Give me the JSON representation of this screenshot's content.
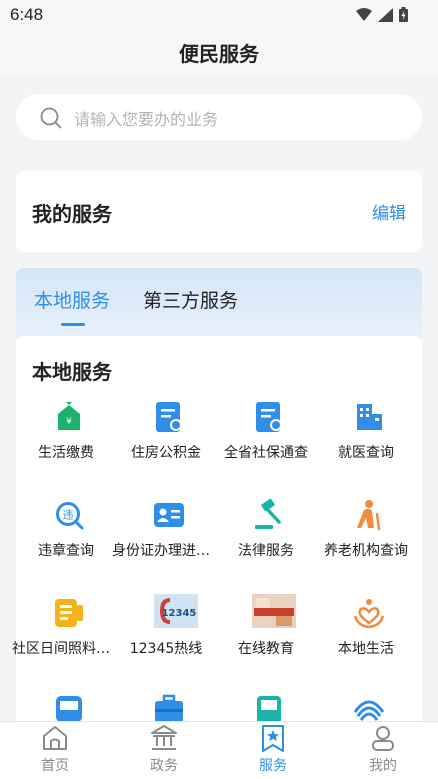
{
  "status": {
    "time": "6:48"
  },
  "header": {
    "title": "便民服务"
  },
  "search": {
    "placeholder": "请输入您要办的业务"
  },
  "my_services": {
    "title": "我的服务",
    "edit_label": "编辑"
  },
  "tabs": [
    {
      "label": "本地服务",
      "active": true
    },
    {
      "label": "第三方服务",
      "active": false
    }
  ],
  "local": {
    "title": "本地服务",
    "items": [
      {
        "label": "生活缴费",
        "icon": "bill-house-icon"
      },
      {
        "label": "住房公积金",
        "icon": "housing-fund-icon"
      },
      {
        "label": "全省社保通查",
        "icon": "social-security-icon"
      },
      {
        "label": "就医查询",
        "icon": "hospital-icon"
      },
      {
        "label": "违章查询",
        "icon": "violation-icon"
      },
      {
        "label": "身份证办理进度查询",
        "icon": "id-card-icon"
      },
      {
        "label": "法律服务",
        "icon": "gavel-icon"
      },
      {
        "label": "养老机构查询",
        "icon": "elderly-icon"
      },
      {
        "label": "社区日间照料中心",
        "icon": "community-care-icon"
      },
      {
        "label": "12345热线",
        "icon": "hotline-12345-icon"
      },
      {
        "label": "在线教育",
        "icon": "education-icon"
      },
      {
        "label": "本地生活",
        "icon": "local-life-icon"
      },
      {
        "label": "",
        "icon": "bus-icon"
      },
      {
        "label": "",
        "icon": "briefcase-icon"
      },
      {
        "label": "",
        "icon": "train-icon"
      },
      {
        "label": "",
        "icon": "china-mobile-icon"
      }
    ]
  },
  "tabbar": [
    {
      "label": "首页",
      "icon": "home-icon",
      "active": false
    },
    {
      "label": "政务",
      "icon": "government-icon",
      "active": false
    },
    {
      "label": "服务",
      "icon": "service-star-icon",
      "active": true
    },
    {
      "label": "我的",
      "icon": "user-icon",
      "active": false
    }
  ],
  "colors": {
    "accent": "#2e8ee8",
    "green": "#1bb36b",
    "orange": "#f28b3c"
  }
}
